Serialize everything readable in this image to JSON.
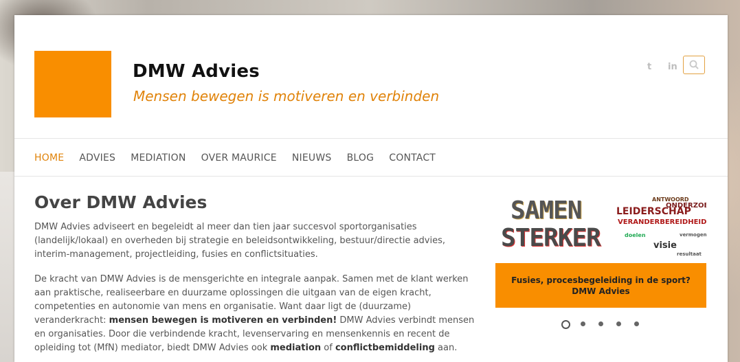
{
  "header": {
    "site_title": "DMW Advies",
    "tagline": "Mensen bewegen is motiveren en verbinden",
    "social": {
      "twitter": "twitter-icon",
      "linkedin": "linkedin-icon",
      "twitter_glyph": "t",
      "linkedin_glyph": "in"
    },
    "search_icon": "search-icon"
  },
  "nav": {
    "items": [
      {
        "label": "HOME",
        "active": true
      },
      {
        "label": "ADVIES"
      },
      {
        "label": "MEDIATION"
      },
      {
        "label": "OVER MAURICE"
      },
      {
        "label": "NIEUWS"
      },
      {
        "label": "BLOG"
      },
      {
        "label": "CONTACT"
      }
    ]
  },
  "main": {
    "heading": "Over DMW Advies",
    "p1": "DMW Advies adviseert en begeleidt al meer dan tien jaar succesvol sportorganisaties (landelijk/lokaal) en overheden bij strategie en beleidsontwikkeling, bestuur/directie advies, interim-management, projectleiding, fusies en conflictsituaties.",
    "p2_a": "De kracht van DMW Advies is de mensgerichte en integrale aanpak. Samen met de klant werken aan praktische, realiseerbare en duurzame oplossingen die uitgaan van de eigen kracht, competenties en autonomie van mens en organisatie. Want daar ligt de (duurzame) veranderkracht: ",
    "p2_b": "mensen bewegen is motiveren en verbinden!",
    "p2_c": " DMW Advies verbindt mensen en organisaties. Door die verbindende kracht, levenservaring en mensenkennis en recent de opleiding tot (MfN) mediator, biedt DMW Advies ook ",
    "p2_d": "mediation",
    "p2_e": " of ",
    "p2_f": "conflictbemiddeling",
    "p2_g": " aan."
  },
  "slider": {
    "image_word1": "SAMEN",
    "image_word2": "STERKER",
    "cloud_words": [
      "LEIDERSCHAP",
      "ONDERZOEK",
      "VERANDERBEREIDHEID",
      "visie",
      "ANTWOORD",
      "vermogen",
      "doelen",
      "resultaat"
    ],
    "caption_line1": "Fusies, procesbegeleiding in de sport?",
    "caption_line2": "DMW Advies",
    "dots": 5,
    "active_dot": 1
  },
  "colors": {
    "accent": "#f98e00",
    "tagline": "#e0830a",
    "text": "#555555"
  }
}
